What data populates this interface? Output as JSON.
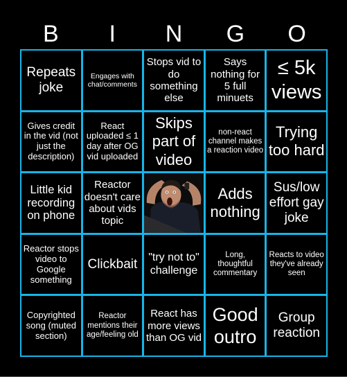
{
  "header": {
    "letters": [
      "B",
      "I",
      "N",
      "G",
      "O"
    ]
  },
  "colors": {
    "background": "#000000",
    "grid_border": "#17b5e8",
    "text": "#ffffff"
  },
  "cells": [
    {
      "text": "Repeats joke"
    },
    {
      "text": "Engages with chat/comments"
    },
    {
      "text": "Stops vid to do something else"
    },
    {
      "text": "Says nothing for 5 full minuets"
    },
    {
      "text": "≤ 5k views"
    },
    {
      "text": "Gives credit in the vid (not just the description)"
    },
    {
      "text": "React uploaded ≤ 1 day after OG vid uploaded"
    },
    {
      "text": "Skips part of video"
    },
    {
      "text": "non-react channel makes a reaction video"
    },
    {
      "text": "Trying too hard"
    },
    {
      "text": "Little kid recording on phone"
    },
    {
      "text": "Reactor doesn't care about vids topic"
    },
    {
      "text": "",
      "free_space": true,
      "image": "shocked-man-photo"
    },
    {
      "text": "Adds nothing"
    },
    {
      "text": "Sus/low effort gay joke"
    },
    {
      "text": "Reactor stops video to Google something"
    },
    {
      "text": "Clickbait"
    },
    {
      "text": "\"try not to\" challenge"
    },
    {
      "text": "Long, thoughtful commentary"
    },
    {
      "text": "Reacts to video they've already seen"
    },
    {
      "text": "Copyrighted song (muted section)"
    },
    {
      "text": "Reactor mentions their age/feeling old"
    },
    {
      "text": "React has more views than OG vid"
    },
    {
      "text": "Good outro"
    },
    {
      "text": "Group reaction"
    }
  ]
}
